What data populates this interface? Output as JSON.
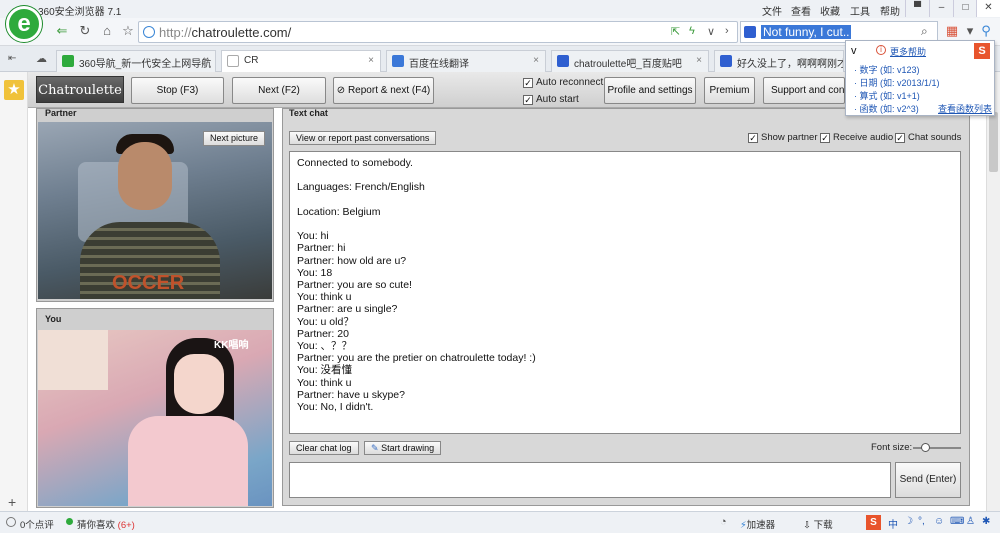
{
  "browser": {
    "title": "360安全浏览器 7.1",
    "menu": [
      "文件",
      "查看",
      "收藏",
      "工具",
      "帮助"
    ],
    "url_scheme": "http://",
    "url_host": "chatroulette.com/",
    "search_query": "Not funny, I cut.."
  },
  "tabs": [
    {
      "label": "360导航_新一代安全上网导航",
      "color": "#2eaa3c"
    },
    {
      "label": "CR",
      "color": "#aaaaaa",
      "active": true
    },
    {
      "label": "百度在线翻译",
      "color": "#3b78d8"
    },
    {
      "label": "chatroulette吧_百度贴吧",
      "color": "#2f5fd0"
    },
    {
      "label": "好久没上了，啊啊啊刚才看见",
      "color": "#2f5fd0"
    }
  ],
  "dropdown": {
    "typed": "v",
    "help": "更多帮助",
    "rows": [
      "· 数字 (如: v123)",
      "· 日期 (如: v2013/1/1)",
      "· 算式 (如: v1+1)",
      "· 函数 (如: v2^3)"
    ],
    "link": "查看函数列表"
  },
  "site": {
    "brand": "Chatroulette",
    "stop": "Stop (F3)",
    "next": "Next (F2)",
    "report_next": "Report & next (F4)",
    "auto_reconnect": "Auto reconnect",
    "auto_start": "Auto start",
    "profile": "Profile and settings",
    "premium": "Premium",
    "support": "Support and contacts"
  },
  "partner": {
    "header": "Partner",
    "next_picture": "Next picture",
    "shirt_text": "OCCER"
  },
  "you": {
    "header": "You",
    "watermark": "KK唱响"
  },
  "chat": {
    "header": "Text chat",
    "past": "View or report past conversations",
    "show_partner": "Show partner",
    "receive_audio": "Receive audio",
    "chat_sounds": "Chat sounds",
    "log": [
      "Connected to somebody.",
      "",
      "Languages: French/English",
      "",
      "Location: Belgium",
      "",
      "You: hi",
      "Partner: hi",
      "Partner: how old are u?",
      "You: 18",
      "Partner: you are so cute!",
      "You: think u",
      "Partner: are u single?",
      "You: u old？",
      "Partner: 20",
      "You: 、？？",
      "Partner: you are the pretier on chatroulette today! :)",
      "You: 没看懂",
      "You: think u",
      "Partner: have u skype?",
      "You: No, I didn't."
    ],
    "clear": "Clear chat log",
    "draw": "Start drawing",
    "font_size": "Font size:",
    "send": "Send (Enter)"
  },
  "status": {
    "comments": "0个点评",
    "guess": "猜你喜欢",
    "guess_count": "(6+)",
    "accelerator": "加速器",
    "download": "下载"
  }
}
